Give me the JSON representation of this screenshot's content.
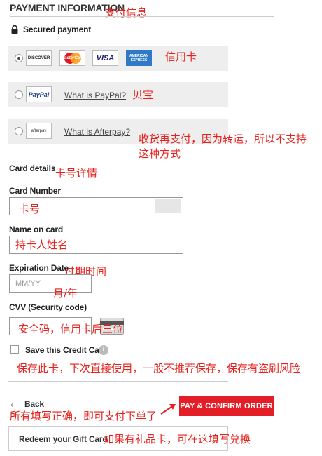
{
  "header": {
    "title": "PAYMENT INFORMATION",
    "title_note": "支付信息"
  },
  "secured": {
    "label": "Secured payment"
  },
  "payment_methods": {
    "credit": {
      "logos": [
        "DISCOVER",
        "MasterCard",
        "VISA",
        "AMERICAN EXPRESS"
      ],
      "note": "信用卡",
      "selected": true
    },
    "paypal": {
      "logo": "PayPal",
      "link": "What is PayPal?",
      "note": "贝宝"
    },
    "afterpay": {
      "logo": "afterpay",
      "link": "What is Afterpay?",
      "note": "收货再支付，因为转运，所以不支持这种方式"
    }
  },
  "card_details": {
    "heading": "Card details",
    "heading_note": "卡号详情",
    "card_number": {
      "label": "Card Number",
      "note": "卡号"
    },
    "name_on_card": {
      "label": "Name on card",
      "note": "持卡人姓名"
    },
    "expiration": {
      "label": "Expiration Date",
      "placeholder": "MM/YY",
      "note": "过期时间",
      "note2": "月/年"
    },
    "cvv": {
      "label": "CVV (Security code)",
      "note": "安全码，信用卡后三位"
    },
    "save": {
      "label": "Save this Credit Card",
      "note": "保存此卡，下次直接使用，一般不推荐保存，保存有盗刷风险"
    }
  },
  "actions": {
    "back": "Back",
    "confirm": "PAY & CONFIRM ORDER",
    "confirm_note": "所有填写正确，即可支付下单了",
    "gift": "Redeem your Gift Card",
    "gift_note": "如果有礼品卡，可在这填写兑换"
  },
  "colors": {
    "accent": "#e41e26",
    "annotation": "#e5211d",
    "row_bg": "#eeeeee"
  }
}
